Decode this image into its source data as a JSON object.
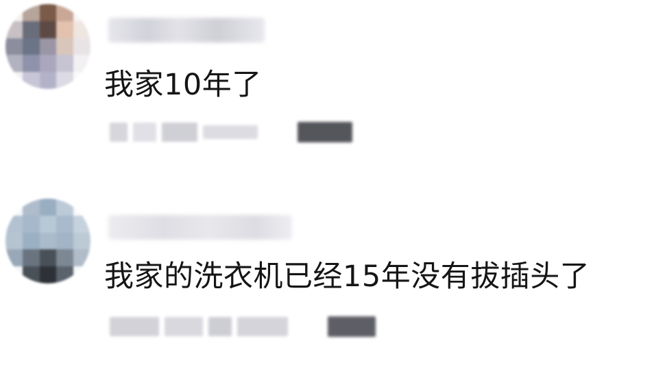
{
  "comments": [
    {
      "text": "我家10年了"
    },
    {
      "text": "我家的洗衣机已经15年没有拔插头了"
    }
  ],
  "colors": {
    "text": "#151515",
    "background": "#ffffff",
    "blurred_meta": "#d0d0d6",
    "blurred_reply": "#5a5a62"
  }
}
